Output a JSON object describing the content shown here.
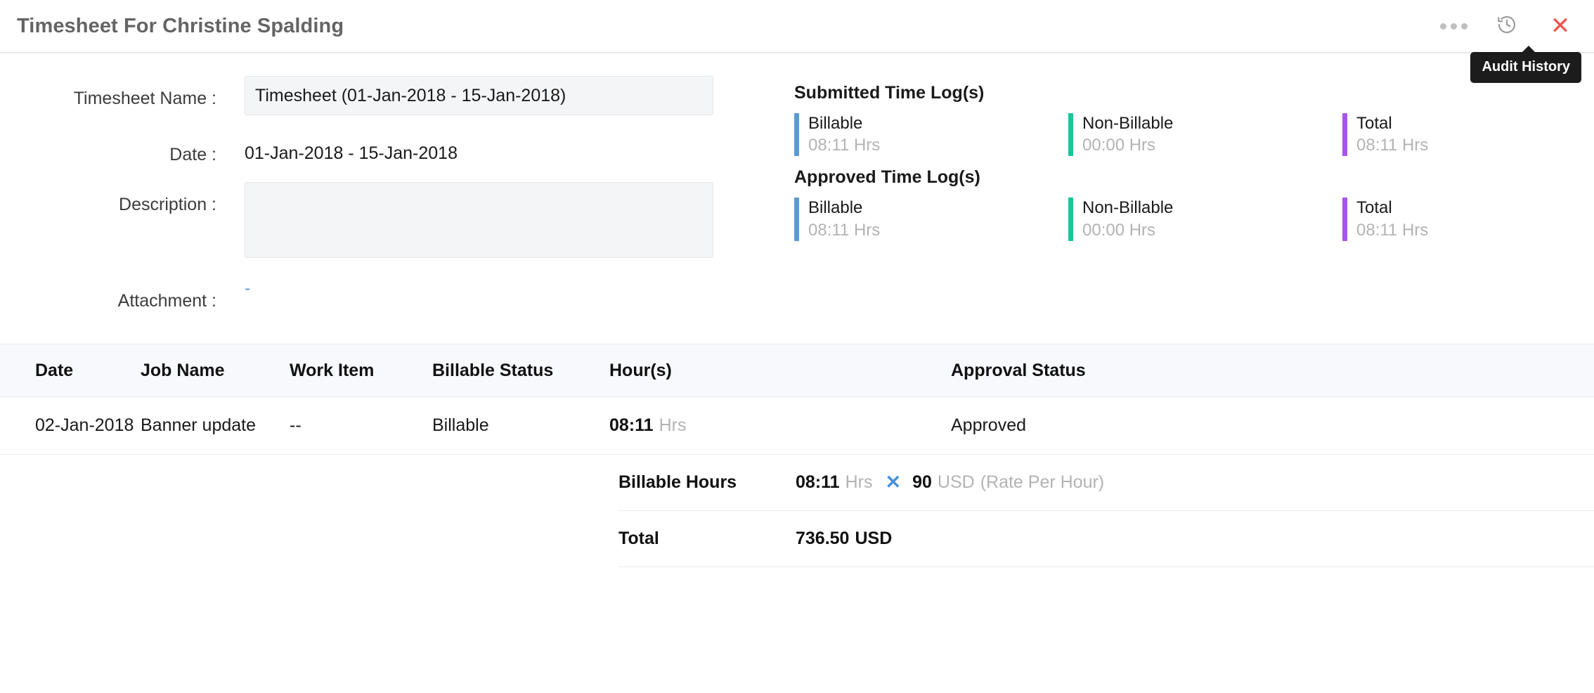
{
  "header": {
    "title": "Timesheet For Christine Spalding",
    "more_icon": "ellipsis-icon",
    "audit_icon": "history-clock-icon",
    "close_icon": "close-icon",
    "tooltip": "Audit History"
  },
  "form": {
    "timesheet_name": {
      "label": "Timesheet Name :",
      "value": "Timesheet (01-Jan-2018 - 15-Jan-2018)",
      "placeholder": "Timesheet Name"
    },
    "date": {
      "label": "Date :",
      "value": "01-Jan-2018 - 15-Jan-2018"
    },
    "description": {
      "label": "Description :",
      "value": "",
      "placeholder": ""
    },
    "attachment": {
      "label": "Attachment :",
      "value": "-"
    }
  },
  "summary": {
    "submitted": {
      "heading": "Submitted Time Log(s)",
      "cards": [
        {
          "label": "Billable",
          "value": "08:11 Hrs",
          "color": "#5b9bd5"
        },
        {
          "label": "Non-Billable",
          "value": "00:00 Hrs",
          "color": "#16c79a"
        },
        {
          "label": "Total",
          "value": "08:11 Hrs",
          "color": "#a855f0"
        }
      ]
    },
    "approved": {
      "heading": "Approved Time Log(s)",
      "cards": [
        {
          "label": "Billable",
          "value": "08:11 Hrs",
          "color": "#5b9bd5"
        },
        {
          "label": "Non-Billable",
          "value": "00:00 Hrs",
          "color": "#16c79a"
        },
        {
          "label": "Total",
          "value": "08:11 Hrs",
          "color": "#a855f0"
        }
      ]
    }
  },
  "table": {
    "columns": {
      "date": "Date",
      "job_name": "Job Name",
      "work_item": "Work Item",
      "billable_status": "Billable Status",
      "hours": "Hour(s)",
      "approval_status": "Approval Status"
    },
    "rows": [
      {
        "date": "02-Jan-2018",
        "job_name": "Banner update",
        "work_item": "--",
        "billable_status": "Billable",
        "hours_value": "08:11",
        "hours_unit": "Hrs",
        "approval_status": "Approved"
      }
    ],
    "totals": {
      "billable_hours_label": "Billable Hours",
      "billable_hours_value": "08:11",
      "billable_hours_unit": "Hrs",
      "multiply_symbol": "✕",
      "rate_value": "90",
      "rate_currency": "USD",
      "rate_note": "(Rate Per Hour)",
      "total_label": "Total",
      "total_amount": "736.50",
      "total_currency": "USD"
    }
  }
}
